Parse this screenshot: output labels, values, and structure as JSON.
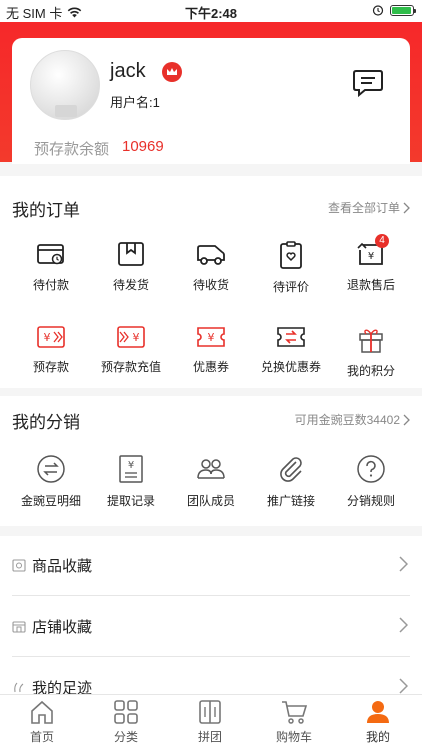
{
  "status_bar": {
    "carrier": "无 SIM 卡",
    "time": "下午2:48"
  },
  "profile": {
    "name": "jack",
    "user_id_label": "用户名:1",
    "balance_label": "预存款余额",
    "balance_value": "10969"
  },
  "orders": {
    "title": "我的订单",
    "link": "查看全部订单",
    "items": [
      {
        "label": "待付款",
        "icon": "wallet-icon"
      },
      {
        "label": "待发货",
        "icon": "box-icon"
      },
      {
        "label": "待收货",
        "icon": "truck-icon"
      },
      {
        "label": "待评价",
        "icon": "clipboard-heart-icon"
      },
      {
        "label": "退款售后",
        "icon": "refund-icon",
        "badge": "4"
      },
      {
        "label": "预存款",
        "icon": "yen-ticket-icon"
      },
      {
        "label": "预存款充值",
        "icon": "yen-recharge-icon"
      },
      {
        "label": "优惠券",
        "icon": "coupon-icon"
      },
      {
        "label": "兑换优惠券",
        "icon": "exchange-coupon-icon"
      },
      {
        "label": "我的积分",
        "icon": "gift-icon"
      }
    ]
  },
  "distribution": {
    "title": "我的分销",
    "link": "可用金豌豆数34402",
    "items": [
      {
        "label": "金豌豆明细",
        "icon": "swap-circle-icon"
      },
      {
        "label": "提取记录",
        "icon": "yen-document-icon"
      },
      {
        "label": "团队成员",
        "icon": "team-icon"
      },
      {
        "label": "推广链接",
        "icon": "paperclip-icon"
      },
      {
        "label": "分销规则",
        "icon": "question-circle-icon"
      }
    ]
  },
  "list_rows": [
    {
      "label": "商品收藏",
      "icon": "product-fav-icon"
    },
    {
      "label": "店铺收藏",
      "icon": "store-fav-icon"
    },
    {
      "label": "我的足迹",
      "icon": "footprint-icon"
    }
  ],
  "tab_bar": {
    "tabs": [
      {
        "label": "首页",
        "icon": "home-icon"
      },
      {
        "label": "分类",
        "icon": "category-icon"
      },
      {
        "label": "拼团",
        "icon": "group-buy-icon"
      },
      {
        "label": "购物车",
        "icon": "cart-icon"
      },
      {
        "label": "我的",
        "icon": "user-icon",
        "active": true
      }
    ]
  },
  "colors": {
    "brand_red": "#e8302a",
    "tab_active": "#f46a12"
  }
}
